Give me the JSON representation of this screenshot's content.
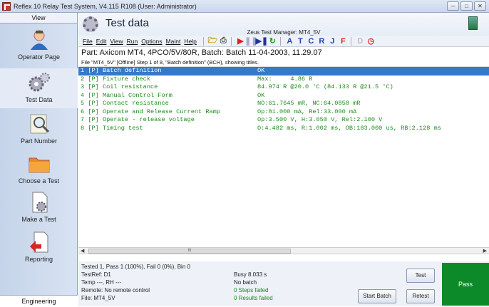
{
  "window": {
    "title": "Reflex 10 Relay Test System, V4.115 R108 (User: Administrator)"
  },
  "sidebar": {
    "header": "View",
    "items": [
      {
        "label": "Operator Page",
        "icon": "operator-icon"
      },
      {
        "label": "Test Data",
        "icon": "gears-icon"
      },
      {
        "label": "Part Number",
        "icon": "magnifier-icon"
      },
      {
        "label": "Choose a Test",
        "icon": "folder-icon"
      },
      {
        "label": "Make a Test",
        "icon": "document-gear-icon"
      },
      {
        "label": "Reporting",
        "icon": "report-arrow-icon"
      }
    ],
    "footer": "Engineering"
  },
  "header": {
    "title": "Test data",
    "manager": "Zeus Test Manager: MT4_5V"
  },
  "menu": [
    "File",
    "Edit",
    "View",
    "Run",
    "Options",
    "Maint",
    "Help"
  ],
  "toolbar": {
    "letters": [
      "A",
      "T",
      "C",
      "R",
      "J",
      "F",
      "D"
    ]
  },
  "part_line": "Part: Axicom MT4, 4PCO/5V/80R, Batch: Batch 11-04-2003, 11.29.07",
  "status_line": "File \"MT4_5V\" [Offline] Step 1 of 8, \"Batch definition\" (BCH), showing titles.",
  "steps": [
    {
      "name": "1 [P] Batch definition",
      "value": "OK"
    },
    {
      "name": "2 [P] Fixture check",
      "value": "Max:     4.86 R"
    },
    {
      "name": "3 [P] Coil resistance",
      "value": "84.974 R @20.0 'C (84.133 R @21.5 'C)"
    },
    {
      "name": "4 [P] Manual Control Form",
      "value": "OK"
    },
    {
      "name": "5 [P] Contact resistance",
      "value": "NO:61.7645 mR, NC:64.0858 mR"
    },
    {
      "name": "6 [P] Operate and Release Current Ramp",
      "value": "Op:81.000 mA, Rel:33.000 mA"
    },
    {
      "name": "7 [P] Operate - release voltage",
      "value": "Op:3.500 V, H:3.050 V, Rel:2.100 V"
    },
    {
      "name": "8 [P] Timing test",
      "value": "O:4.482 ms, R:1.002 ms, OB:183.000 us, RB:2.128 ms"
    }
  ],
  "scrollbar": {
    "thumb": "III"
  },
  "bottom": {
    "summary": "Tested 1, Pass 1 (100%), Fail 0 (0%), Bin 0",
    "testref": "TestRef: D1",
    "temp": "Temp ---, RH ---",
    "remote": "Remote: No remote control",
    "file": "File: MT4_5V",
    "busy": "Busy 8.033 s",
    "batch": "No batch",
    "steps_failed": "0 Steps failed",
    "results_failed": "0 Results failed",
    "test_btn": "Test",
    "start_batch_btn": "Start Batch",
    "retest_btn": "Retest",
    "pass_label": "Pass"
  },
  "colors": {
    "pass": "#0c8a2a",
    "result_text": "#1d8a1d",
    "selected_row": "#3579c9"
  }
}
